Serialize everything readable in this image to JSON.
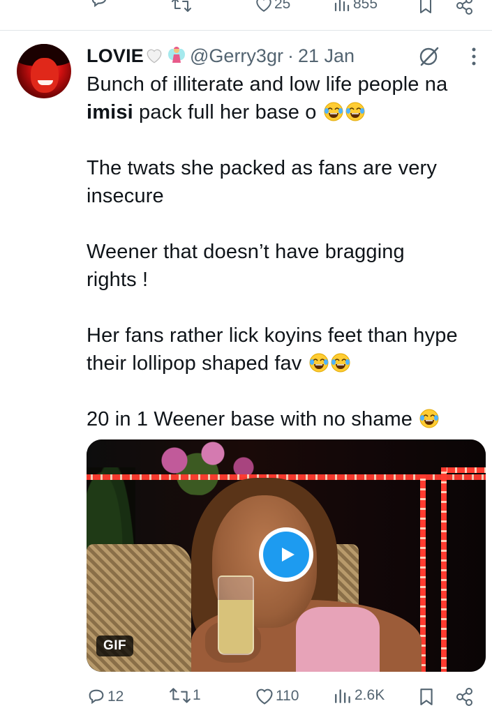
{
  "previous_tweet": {
    "likes": "25",
    "views": "855"
  },
  "tweet": {
    "display_name": "LOVIE",
    "handle": "@Gerry3gr",
    "separator": "·",
    "date": "21 Jan",
    "text": {
      "p1_a": "Bunch of illiterate and low life people na ",
      "p1_bold": "imisi",
      "p1_b": " pack full her base o ",
      "p2": "The twats she packed as fans are very insecure",
      "p3": "Weener that doesn’t have bragging rights !",
      "p4": "Her fans rather lick koyins feet than hype their lollipop shaped fav ",
      "p5": "20 in 1 Weener base with no shame "
    },
    "media": {
      "badge": "GIF"
    },
    "stats": {
      "replies": "12",
      "retweets": "1",
      "likes": "110",
      "views": "2.6K"
    }
  },
  "icons": [
    "reply-icon",
    "retweet-icon",
    "heart-icon",
    "views-icon",
    "bookmark-icon",
    "share-icon",
    "grok-icon",
    "more-icon",
    "play-icon",
    "laughing-emoji",
    "white-heart-emoji",
    "fairy-emoji"
  ],
  "colors": {
    "muted": "#536471",
    "text": "#0f1419",
    "accent": "#1d9bf0",
    "divider": "#e1e5e8"
  }
}
